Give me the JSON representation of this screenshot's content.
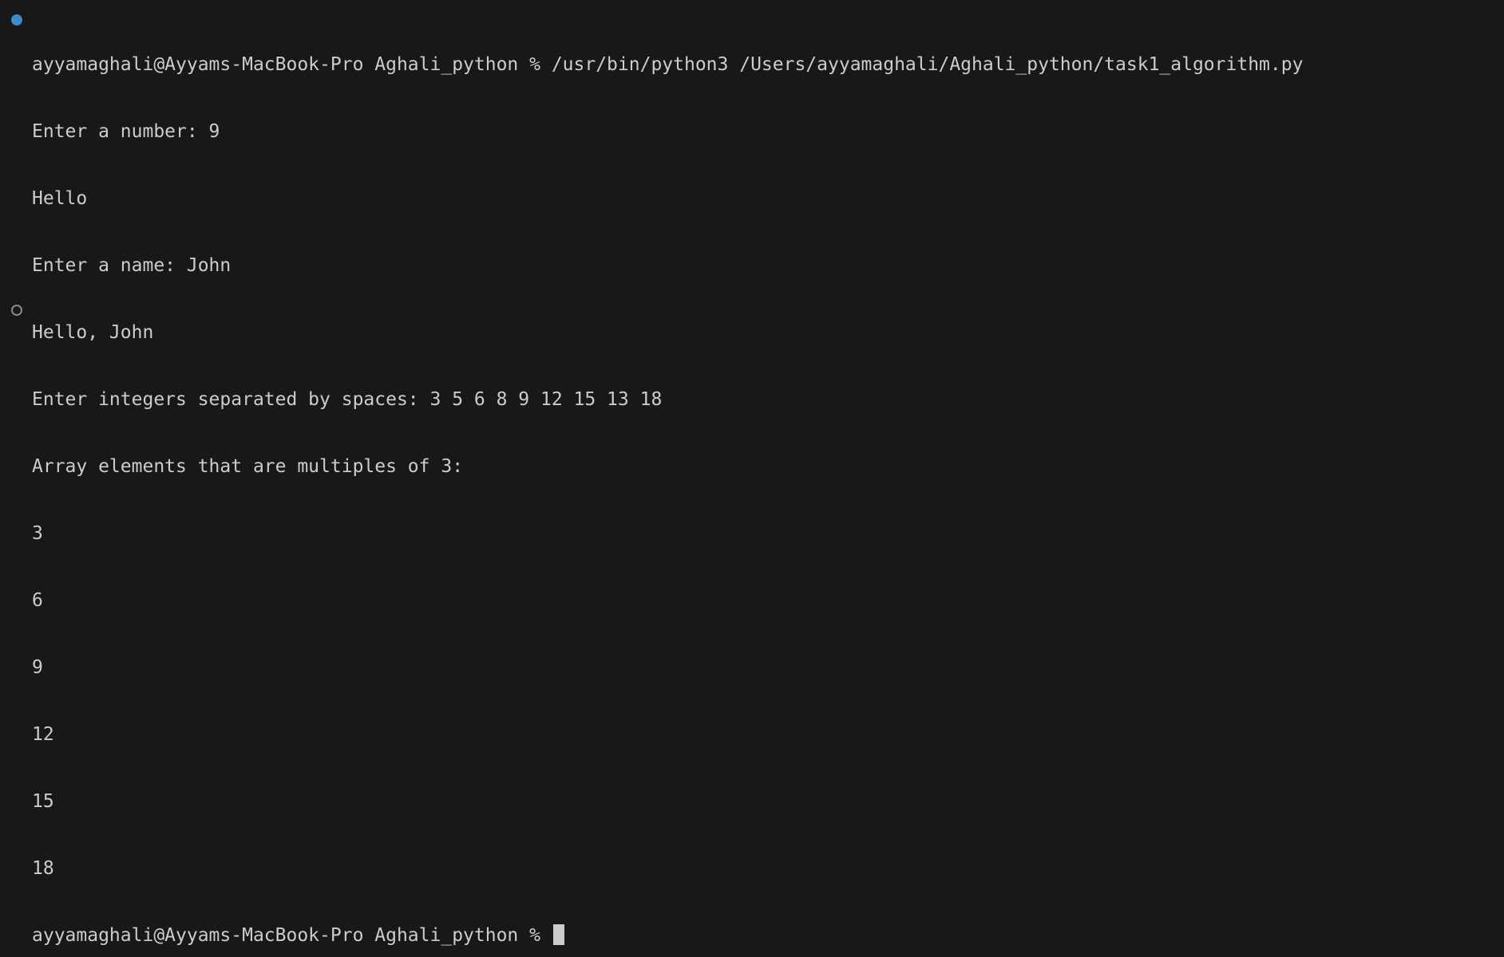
{
  "terminal": {
    "background": "#181818",
    "foreground": "#cccccc",
    "decoration_success_color": "#3f8bc6",
    "decoration_pending_color": "#8a8a8a",
    "command_line": "ayyamaghali@Ayyams-MacBook-Pro Aghali_python % /usr/bin/python3 /Users/ayyamaghali/Aghali_python/task1_algorithm.py",
    "output": [
      "Enter a number: 9",
      "Hello",
      "Enter a name: John",
      "Hello, John",
      "Enter integers separated by spaces: 3 5 6 8 9 12 15 13 18",
      "Array elements that are multiples of 3:",
      "3",
      "6",
      "9",
      "12",
      "15",
      "18"
    ],
    "prompt": "ayyamaghali@Ayyams-MacBook-Pro Aghali_python % "
  }
}
